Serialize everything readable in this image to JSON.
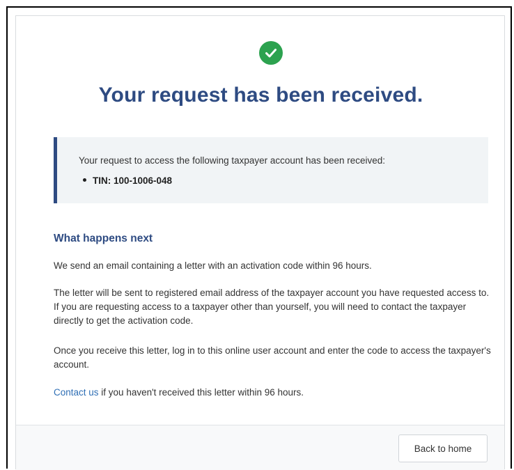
{
  "title": "Your request has been received.",
  "notice": {
    "text": "Your request to access the following taxpayer account has been received:",
    "items": [
      "TIN: 100-1006-048"
    ]
  },
  "next": {
    "heading": "What happens next",
    "paragraphs": [
      "We send an email containing a letter with an activation code within 96 hours.",
      "The letter will be sent to registered email address of the taxpayer account you have requested access to. If you are requesting access to a taxpayer other than yourself, you will need to contact the taxpayer directly to get the activation code.",
      "Once you receive this letter, log in to this online user account and enter the code to access the taxpayer's account."
    ],
    "contact_link": "Contact us",
    "contact_rest": " if you haven't received this letter within 96 hours."
  },
  "footer": {
    "back_label": "Back to home"
  },
  "colors": {
    "accent": "#2e4b82",
    "success": "#2ca24f",
    "link": "#2f6fb5",
    "notice_bg": "#f1f4f6"
  },
  "icons": {
    "success": "check-circle-icon"
  }
}
